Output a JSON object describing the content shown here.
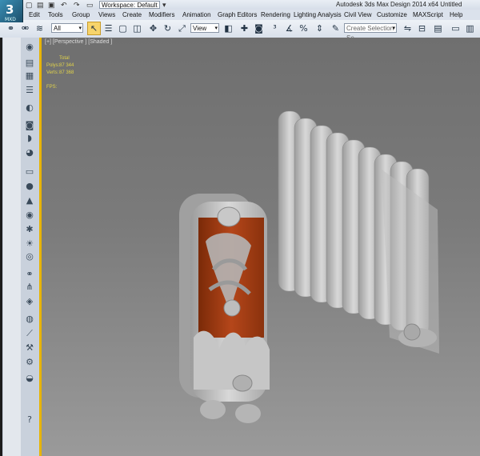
{
  "titlebar": {
    "title": "Autodesk 3ds Max Design 2014 x64    Untitled",
    "workspace": "Workspace: Default",
    "logo_text": "MXD"
  },
  "menu": {
    "items": [
      "Edit",
      "Tools",
      "Group",
      "Views",
      "Create",
      "Modifiers",
      "Animation",
      "Graph Editors",
      "Rendering",
      "Lighting Analysis",
      "Civil View",
      "Customize",
      "MAXScript",
      "Help"
    ]
  },
  "toolbar": {
    "filter_value": "All",
    "refcoord_value": "View",
    "selection_set_placeholder": "Create Selection Se"
  },
  "viewport": {
    "label": "[+] [Perspective ] [Shaded ]",
    "stats_header": "Total",
    "polys_label": "Polys:",
    "polys_value": "87 344",
    "verts_label": "Verts:",
    "verts_value": "87 368",
    "fps_label": "FPS:"
  },
  "colors": {
    "accent_select": "#f7d46b",
    "panel_edge": "#e8b400",
    "stats_text": "#e0d24a",
    "radiator_body": "#a33c12",
    "radiator_cast": "#c9c9c9"
  },
  "left_panel_icons": [
    "viewport-icon",
    "layers-icon",
    "scene-explorer-icon",
    "list-icon",
    "light-bulb-icon",
    "camera-icon",
    "display-icon",
    "material-icon",
    "box-icon",
    "sphere-icon",
    "cone-icon",
    "eye-icon",
    "particle-icon",
    "sun-icon",
    "circle-icon",
    "link-icon",
    "hierarchy-icon",
    "modifier-icon",
    "globe-icon",
    "bone-icon",
    "utility-icon",
    "wrench-icon",
    "teapot-icon",
    "help-icon"
  ]
}
